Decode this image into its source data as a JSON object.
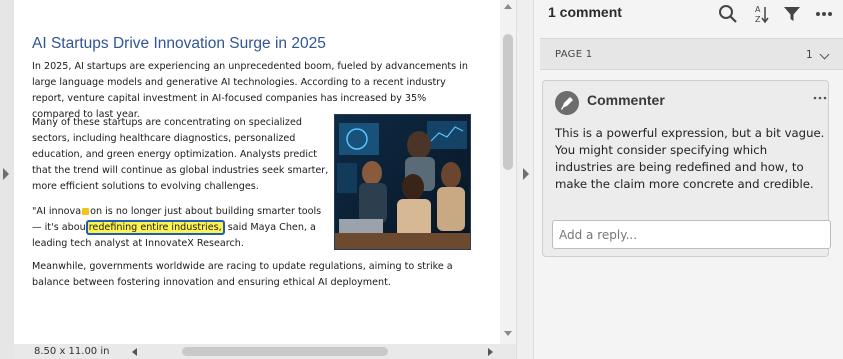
{
  "document": {
    "title": "AI Startups Drive Innovation Surge in 2025",
    "paragraph1": "In 2025, AI startups are experiencing an unprecedented boom, fueled by advancements in large language models and generative AI technologies. According to a recent industry report, venture capital investment in AI-focused companies has increased by 35% compared to last year.",
    "paragraph2": "Many of these startups are concentrating on specialized sectors, including healthcare diagnostics, personalized education, and green energy optimization. Analysts predict that the trend will continue as global industries seek smarter, more efficient solutions to evolving challenges.",
    "paragraph3": {
      "before_marker": "\"AI innova",
      "after_marker": "on is no longer just about building smarter tools — it's abou",
      "highlight": "redefining entire industries,",
      "after_highlight": " said Maya Chen, a leading tech analyst at InnovateX Research."
    },
    "paragraph4": "Meanwhile, governments worldwide are racing to update regulations, aiming to strike a balance between fostering innovation and ensuring ethical AI deployment."
  },
  "statusbar": {
    "page_size": "8.50 x 11.00 in"
  },
  "comments_panel": {
    "count_label": "1 comment",
    "icons": [
      "search-icon",
      "sort-az-icon",
      "filter-icon",
      "more-icon"
    ],
    "page_group": {
      "label": "PAGE 1",
      "count": "1"
    },
    "comment": {
      "author": "Commenter",
      "text": "This is a powerful expression, but a bit vague. You might consider specifying which industries are being redefined and how, to make the claim more concrete and credible.",
      "reply_placeholder": "Add a reply..."
    }
  },
  "colors": {
    "title": "#2f5597",
    "highlight": "#fff44f",
    "highlight_border": "#1f5eb8"
  }
}
